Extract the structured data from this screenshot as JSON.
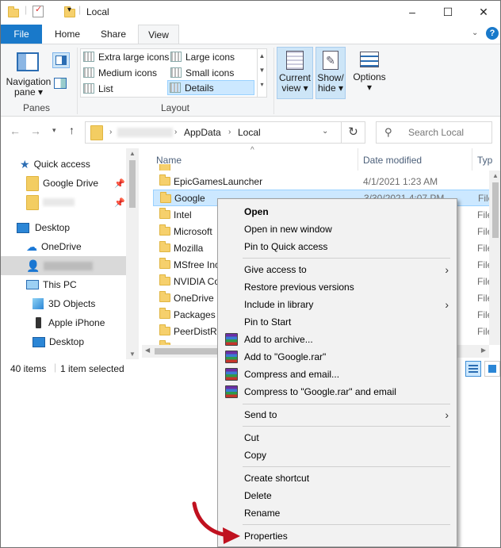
{
  "window": {
    "title": "Local",
    "minimize": "–",
    "maximize": "☐",
    "close": "✕"
  },
  "ribbon_tabs": [
    "File",
    "Home",
    "Share",
    "View"
  ],
  "ribbon": {
    "nav_pane_label": "Navigation pane",
    "nav_pane_line1": "Navigation",
    "nav_pane_line2": "pane",
    "panes_group": "Panes",
    "layout_options": [
      "Extra large icons",
      "Large icons",
      "Medium icons",
      "Small icons",
      "List",
      "Details"
    ],
    "layout_group": "Layout",
    "current_view_line1": "Current",
    "current_view_line2": "view",
    "showhide_line1": "Show/",
    "showhide_line2": "hide",
    "options": "Options"
  },
  "address": {
    "breadcrumb": [
      "AppData",
      "Local"
    ],
    "search_placeholder": "Search Local"
  },
  "nav_pane": {
    "items": [
      "Quick access",
      "Google Drive",
      "Desktop",
      "OneDrive",
      "This PC",
      "3D Objects",
      "Apple iPhone",
      "Desktop"
    ]
  },
  "list": {
    "columns": [
      "Name",
      "Date modified",
      "Typ"
    ],
    "rows": [
      {
        "name": "EpicGamesLauncher",
        "date": "4/1/2021 1:23 AM",
        "type": ""
      },
      {
        "name": "Google",
        "date": "3/30/2021 4:07 PM",
        "type": "File"
      },
      {
        "name": "Intel",
        "date": "",
        "type": "File"
      },
      {
        "name": "Microsoft",
        "date": "",
        "type": "File"
      },
      {
        "name": "Mozilla",
        "date": "",
        "type": "File"
      },
      {
        "name": "MSfree Inc",
        "date": "",
        "type": "File"
      },
      {
        "name": "NVIDIA Co",
        "date": "",
        "type": "File"
      },
      {
        "name": "OneDrive",
        "date": "",
        "type": "File"
      },
      {
        "name": "Packages",
        "date": "",
        "type": "File"
      },
      {
        "name": "PeerDistRe",
        "date": "",
        "type": "File"
      }
    ]
  },
  "status": {
    "count": "40 items",
    "selected": "1 item selected"
  },
  "context_menu": {
    "items": [
      "Open",
      "Open in new window",
      "Pin to Quick access",
      "Give access to",
      "Restore previous versions",
      "Include in library",
      "Pin to Start",
      "Add to archive...",
      "Add to \"Google.rar\"",
      "Compress and email...",
      "Compress to \"Google.rar\" and email",
      "Send to",
      "Cut",
      "Copy",
      "Create shortcut",
      "Delete",
      "Rename",
      "Properties"
    ]
  },
  "colors": {
    "file_tab": "#1979ca",
    "selection": "#cce8ff",
    "annotation_arrow": "#c0111f"
  }
}
